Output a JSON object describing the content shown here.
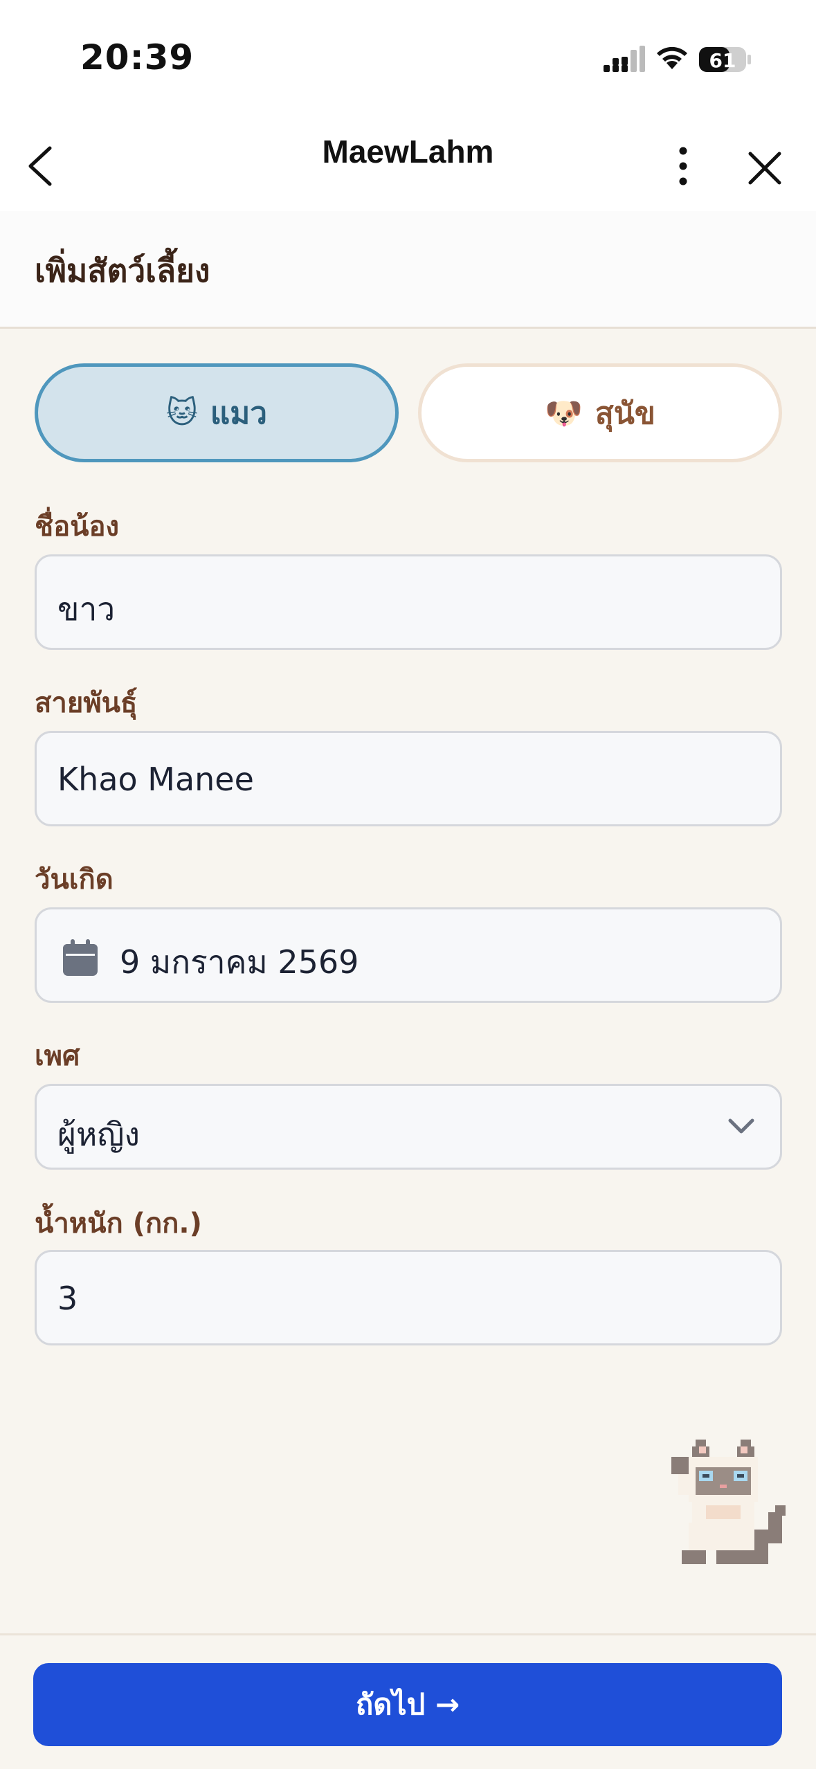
{
  "status_bar": {
    "time": "20:39",
    "battery": "61"
  },
  "nav": {
    "title": "MaewLahm"
  },
  "page": {
    "title": "เพิ่มสัตว์เลี้ยง"
  },
  "species": {
    "cat_emoji": "🐱",
    "cat_label": "แมว",
    "dog_emoji": "🐶",
    "dog_label": "สุนัข",
    "selected": "cat"
  },
  "form": {
    "name_label": "ชื่อน้อง",
    "name_value": "ขาว",
    "breed_label": "สายพันธุ์",
    "breed_value": "Khao Manee",
    "birthday_label": "วันเกิด",
    "birthday_value": "9 มกราคม 2569",
    "sex_label": "เพศ",
    "sex_value": "ผู้หญิง",
    "weight_label": "น้ำหนัก (กก.)",
    "weight_value": "3"
  },
  "footer": {
    "next_label": "ถัดไป →"
  },
  "colors": {
    "primary": "#1f4fd8",
    "label_brown": "#6b3e27",
    "selected_bg": "#d3e3ec",
    "selected_border": "#4f97bd"
  }
}
